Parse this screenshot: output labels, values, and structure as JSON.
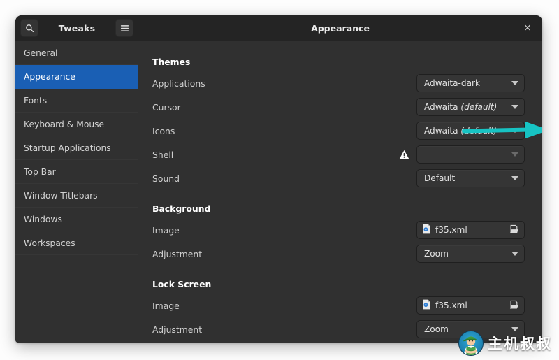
{
  "window": {
    "app_title": "Tweaks",
    "page_title": "Appearance",
    "close_label": "×",
    "search_icon": "search-icon",
    "menu_icon": "hamburger-menu-icon"
  },
  "sidebar": {
    "items": [
      {
        "label": "General",
        "selected": false
      },
      {
        "label": "Appearance",
        "selected": true
      },
      {
        "label": "Fonts",
        "selected": false
      },
      {
        "label": "Keyboard & Mouse",
        "selected": false
      },
      {
        "label": "Startup Applications",
        "selected": false
      },
      {
        "label": "Top Bar",
        "selected": false
      },
      {
        "label": "Window Titlebars",
        "selected": false
      },
      {
        "label": "Windows",
        "selected": false
      },
      {
        "label": "Workspaces",
        "selected": false
      }
    ]
  },
  "content": {
    "groups": [
      {
        "title": "Themes",
        "rows": [
          {
            "label": "Applications",
            "widget": "combo",
            "value": "Adwaita-dark",
            "suffix": "",
            "disabled": false,
            "warning": false,
            "highlighted": true
          },
          {
            "label": "Cursor",
            "widget": "combo",
            "value": "Adwaita ",
            "suffix": "(default)",
            "disabled": false,
            "warning": false,
            "highlighted": false
          },
          {
            "label": "Icons",
            "widget": "combo",
            "value": "Adwaita ",
            "suffix": "(default)",
            "disabled": false,
            "warning": false,
            "highlighted": false
          },
          {
            "label": "Shell",
            "widget": "combo",
            "value": "",
            "suffix": "",
            "disabled": true,
            "warning": true,
            "highlighted": false
          },
          {
            "label": "Sound",
            "widget": "combo",
            "value": "Default",
            "suffix": "",
            "disabled": false,
            "warning": false,
            "highlighted": false
          }
        ]
      },
      {
        "title": "Background",
        "rows": [
          {
            "label": "Image",
            "widget": "file",
            "value": "f35.xml",
            "suffix": "",
            "disabled": false,
            "warning": false,
            "highlighted": false
          },
          {
            "label": "Adjustment",
            "widget": "combo",
            "value": "Zoom",
            "suffix": "",
            "disabled": false,
            "warning": false,
            "highlighted": false
          }
        ]
      },
      {
        "title": "Lock Screen",
        "rows": [
          {
            "label": "Image",
            "widget": "file",
            "value": "f35.xml",
            "suffix": "",
            "disabled": false,
            "warning": false,
            "highlighted": false
          },
          {
            "label": "Adjustment",
            "widget": "combo",
            "value": "Zoom",
            "suffix": "",
            "disabled": false,
            "warning": false,
            "highlighted": false
          }
        ]
      }
    ]
  },
  "annotation": {
    "color": "#17c3c3",
    "arrow_target": "applications-theme-combo",
    "highlight_target": "applications-theme-combo"
  },
  "watermark": {
    "text": "主机叔叔"
  }
}
